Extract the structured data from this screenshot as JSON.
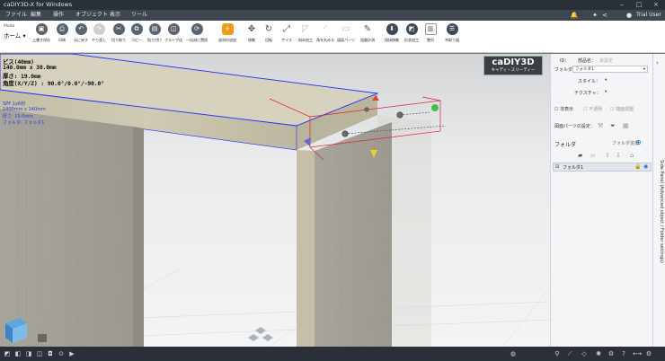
{
  "window": {
    "title": "caDIY3D-X for Windows"
  },
  "menu": {
    "items": [
      "ファイル",
      "編集",
      "操作",
      "オブジェクト",
      "表示",
      "ツール"
    ],
    "user": "Trial User"
  },
  "toolbar": {
    "mode_label": "Mode",
    "mode_value": "ホーム",
    "buttons": [
      {
        "name": "overwrite-save-button",
        "label": "上書き保存",
        "icon": "save-icon"
      },
      {
        "name": "print-button",
        "label": "印刷",
        "icon": "print-icon"
      },
      {
        "name": "undo-button",
        "label": "元に戻す",
        "icon": "undo-icon"
      },
      {
        "name": "redo-button",
        "label": "やり直し",
        "icon": "redo-icon"
      },
      {
        "name": "cut-button",
        "label": "切り取り",
        "icon": "scissors-icon"
      },
      {
        "name": "copy-button",
        "label": "コピー",
        "icon": "copy-icon"
      },
      {
        "name": "paste-button",
        "label": "貼り付け",
        "icon": "paste-icon"
      },
      {
        "name": "group-button",
        "label": "グループ化",
        "icon": "group-icon"
      },
      {
        "name": "bulk-replace-button",
        "label": "一括材に置換",
        "icon": "replace-icon"
      },
      {
        "name": "add-material-button",
        "label": "部材の追加",
        "icon": "add-material-icon"
      },
      {
        "name": "move-button",
        "label": "移動",
        "icon": "move-icon"
      },
      {
        "name": "rotate-button",
        "label": "回転",
        "icon": "rotate-icon"
      },
      {
        "name": "size-button",
        "label": "サイズ",
        "icon": "size-icon"
      },
      {
        "name": "oblique-cut-button",
        "label": "斜め加工",
        "icon": "oblique-cut-icon"
      },
      {
        "name": "corner-round-button",
        "label": "角を丸める",
        "icon": "corner-round-icon"
      },
      {
        "name": "surface-part-button",
        "label": "図面パーツ",
        "icon": "surface-part-icon"
      },
      {
        "name": "dimension-button",
        "label": "距離計測",
        "icon": "dimension-icon"
      },
      {
        "name": "contact-move-button",
        "label": "接接移動",
        "icon": "contact-move-icon"
      },
      {
        "name": "shape-process-button",
        "label": "形状加工",
        "icon": "shape-process-icon"
      },
      {
        "name": "arrange-button",
        "label": "整列",
        "icon": "arrange-icon"
      },
      {
        "name": "cut-list-button",
        "label": "木取り図",
        "icon": "cut-list-icon"
      }
    ]
  },
  "viewport": {
    "info_lines": [
      "ビス(40mm)",
      "140.0mm x 38.0mm",
      "厚さ: 19.0mm",
      "角度(X/Y/Z) : 90.0°/0.0°/-90.0°"
    ],
    "selected_lines": [
      "SPF 1x6材",
      "1400mm x 140mm",
      "厚さ: 19.0mm",
      "フォルダ: フォルダ1"
    ],
    "logo_main": "caDIY3D",
    "logo_sub": "キャディ・スリーディー"
  },
  "panel": {
    "name_label": "ID：",
    "name_field_label": "部品名：",
    "name_placeholder": "未設定",
    "folder_label": "フォルダ",
    "folder_value": "フォルダ1",
    "style_label": "スタイル：",
    "texture_label": "テクスチャ：",
    "chk_hide": "非表示",
    "chk_transparent": "不透明",
    "chk_fit": "端面調整",
    "surface_parts_label": "図面パーツの設定：",
    "folder_section": "フォルダ",
    "folder_add_label": "フォルダ追加",
    "folder_row": "フォルダ1",
    "side_tab": "Side Panel (Advanced object / Folder settings)"
  },
  "colors": {
    "accent": "#f29b1a",
    "dark": "#2a3038",
    "selection": "#1f2bff",
    "highlight": "#e0232e"
  }
}
